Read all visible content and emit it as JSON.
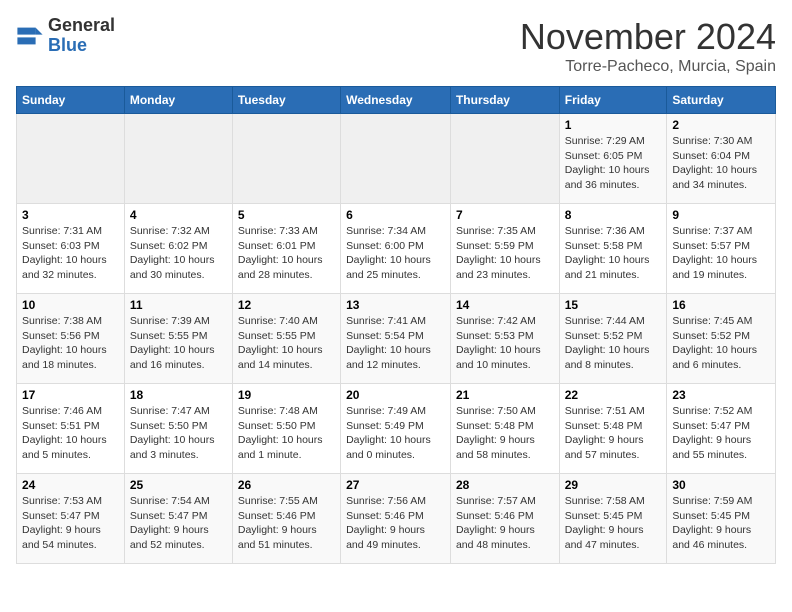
{
  "header": {
    "logo_line1": "General",
    "logo_line2": "Blue",
    "month": "November 2024",
    "location": "Torre-Pacheco, Murcia, Spain"
  },
  "weekdays": [
    "Sunday",
    "Monday",
    "Tuesday",
    "Wednesday",
    "Thursday",
    "Friday",
    "Saturday"
  ],
  "weeks": [
    [
      {
        "day": "",
        "info": ""
      },
      {
        "day": "",
        "info": ""
      },
      {
        "day": "",
        "info": ""
      },
      {
        "day": "",
        "info": ""
      },
      {
        "day": "",
        "info": ""
      },
      {
        "day": "1",
        "info": "Sunrise: 7:29 AM\nSunset: 6:05 PM\nDaylight: 10 hours and 36 minutes."
      },
      {
        "day": "2",
        "info": "Sunrise: 7:30 AM\nSunset: 6:04 PM\nDaylight: 10 hours and 34 minutes."
      }
    ],
    [
      {
        "day": "3",
        "info": "Sunrise: 7:31 AM\nSunset: 6:03 PM\nDaylight: 10 hours and 32 minutes."
      },
      {
        "day": "4",
        "info": "Sunrise: 7:32 AM\nSunset: 6:02 PM\nDaylight: 10 hours and 30 minutes."
      },
      {
        "day": "5",
        "info": "Sunrise: 7:33 AM\nSunset: 6:01 PM\nDaylight: 10 hours and 28 minutes."
      },
      {
        "day": "6",
        "info": "Sunrise: 7:34 AM\nSunset: 6:00 PM\nDaylight: 10 hours and 25 minutes."
      },
      {
        "day": "7",
        "info": "Sunrise: 7:35 AM\nSunset: 5:59 PM\nDaylight: 10 hours and 23 minutes."
      },
      {
        "day": "8",
        "info": "Sunrise: 7:36 AM\nSunset: 5:58 PM\nDaylight: 10 hours and 21 minutes."
      },
      {
        "day": "9",
        "info": "Sunrise: 7:37 AM\nSunset: 5:57 PM\nDaylight: 10 hours and 19 minutes."
      }
    ],
    [
      {
        "day": "10",
        "info": "Sunrise: 7:38 AM\nSunset: 5:56 PM\nDaylight: 10 hours and 18 minutes."
      },
      {
        "day": "11",
        "info": "Sunrise: 7:39 AM\nSunset: 5:55 PM\nDaylight: 10 hours and 16 minutes."
      },
      {
        "day": "12",
        "info": "Sunrise: 7:40 AM\nSunset: 5:55 PM\nDaylight: 10 hours and 14 minutes."
      },
      {
        "day": "13",
        "info": "Sunrise: 7:41 AM\nSunset: 5:54 PM\nDaylight: 10 hours and 12 minutes."
      },
      {
        "day": "14",
        "info": "Sunrise: 7:42 AM\nSunset: 5:53 PM\nDaylight: 10 hours and 10 minutes."
      },
      {
        "day": "15",
        "info": "Sunrise: 7:44 AM\nSunset: 5:52 PM\nDaylight: 10 hours and 8 minutes."
      },
      {
        "day": "16",
        "info": "Sunrise: 7:45 AM\nSunset: 5:52 PM\nDaylight: 10 hours and 6 minutes."
      }
    ],
    [
      {
        "day": "17",
        "info": "Sunrise: 7:46 AM\nSunset: 5:51 PM\nDaylight: 10 hours and 5 minutes."
      },
      {
        "day": "18",
        "info": "Sunrise: 7:47 AM\nSunset: 5:50 PM\nDaylight: 10 hours and 3 minutes."
      },
      {
        "day": "19",
        "info": "Sunrise: 7:48 AM\nSunset: 5:50 PM\nDaylight: 10 hours and 1 minute."
      },
      {
        "day": "20",
        "info": "Sunrise: 7:49 AM\nSunset: 5:49 PM\nDaylight: 10 hours and 0 minutes."
      },
      {
        "day": "21",
        "info": "Sunrise: 7:50 AM\nSunset: 5:48 PM\nDaylight: 9 hours and 58 minutes."
      },
      {
        "day": "22",
        "info": "Sunrise: 7:51 AM\nSunset: 5:48 PM\nDaylight: 9 hours and 57 minutes."
      },
      {
        "day": "23",
        "info": "Sunrise: 7:52 AM\nSunset: 5:47 PM\nDaylight: 9 hours and 55 minutes."
      }
    ],
    [
      {
        "day": "24",
        "info": "Sunrise: 7:53 AM\nSunset: 5:47 PM\nDaylight: 9 hours and 54 minutes."
      },
      {
        "day": "25",
        "info": "Sunrise: 7:54 AM\nSunset: 5:47 PM\nDaylight: 9 hours and 52 minutes."
      },
      {
        "day": "26",
        "info": "Sunrise: 7:55 AM\nSunset: 5:46 PM\nDaylight: 9 hours and 51 minutes."
      },
      {
        "day": "27",
        "info": "Sunrise: 7:56 AM\nSunset: 5:46 PM\nDaylight: 9 hours and 49 minutes."
      },
      {
        "day": "28",
        "info": "Sunrise: 7:57 AM\nSunset: 5:46 PM\nDaylight: 9 hours and 48 minutes."
      },
      {
        "day": "29",
        "info": "Sunrise: 7:58 AM\nSunset: 5:45 PM\nDaylight: 9 hours and 47 minutes."
      },
      {
        "day": "30",
        "info": "Sunrise: 7:59 AM\nSunset: 5:45 PM\nDaylight: 9 hours and 46 minutes."
      }
    ]
  ]
}
